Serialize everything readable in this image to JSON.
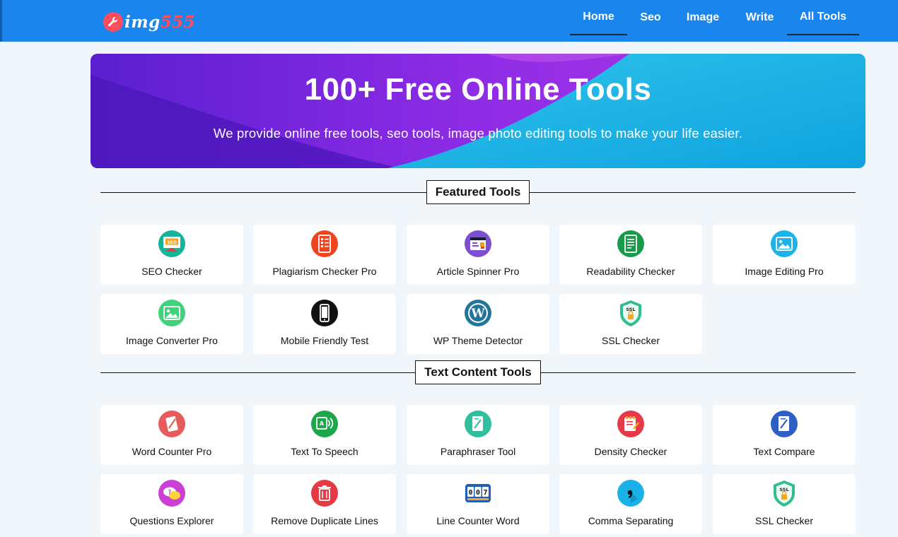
{
  "brand": {
    "logo_text_prefix": "img",
    "logo_text_number": "555"
  },
  "nav": {
    "items": [
      {
        "label": "Home",
        "active": true
      },
      {
        "label": "Seo",
        "active": false
      },
      {
        "label": "Image",
        "active": false
      },
      {
        "label": "Write",
        "active": false
      },
      {
        "label": "All Tools",
        "active": true
      }
    ]
  },
  "hero": {
    "title": "100+ Free Online Tools",
    "subtitle": "We provide online free tools, seo tools, image photo editing tools to make your life easier."
  },
  "sections": [
    {
      "title": "Featured Tools",
      "tools": [
        {
          "label": "SEO Checker",
          "icon": "seo-monitor-icon",
          "color": "#15b39a"
        },
        {
          "label": "Plagiarism Checker Pro",
          "icon": "checklist-icon",
          "color": "#f0441f"
        },
        {
          "label": "Article Spinner Pro",
          "icon": "article-icon",
          "color": "#7c4fd1"
        },
        {
          "label": "Readability Checker",
          "icon": "document-icon",
          "color": "#189a4a"
        },
        {
          "label": "Image Editing Pro",
          "icon": "image-icon",
          "color": "#1eb3e8"
        },
        {
          "label": "Image Converter Pro",
          "icon": "image-convert-icon",
          "color": "#3fd27a"
        },
        {
          "label": "Mobile Friendly Test",
          "icon": "mobile-icon",
          "color": "#111111"
        },
        {
          "label": "WP Theme Detector",
          "icon": "wordpress-icon",
          "color": "#21759b"
        },
        {
          "label": "SSL Checker",
          "icon": "ssl-shield-icon",
          "color": "#2fbf8f"
        }
      ]
    },
    {
      "title": "Text Content Tools",
      "tools": [
        {
          "label": "Word Counter Pro",
          "icon": "word-counter-icon",
          "color": "#e85b5b"
        },
        {
          "label": "Text To Speech",
          "icon": "text-speech-icon",
          "color": "#1ea74a"
        },
        {
          "label": "Paraphraser Tool",
          "icon": "paraphrase-icon",
          "color": "#2fbf9e"
        },
        {
          "label": "Density Checker",
          "icon": "density-icon",
          "color": "#e63a4a"
        },
        {
          "label": "Text Compare",
          "icon": "compare-icon",
          "color": "#2f5fc4"
        },
        {
          "label": "Questions Explorer",
          "icon": "question-bubbles-icon",
          "color": "#cc3fd6"
        },
        {
          "label": "Remove Duplicate Lines",
          "icon": "trash-icon",
          "color": "#e63946"
        },
        {
          "label": "Line Counter Word",
          "icon": "counter-icon",
          "color": "#1f5fb8"
        },
        {
          "label": "Comma Separating",
          "icon": "comma-icon",
          "color": "#1ab1e6"
        },
        {
          "label": "SSL Checker",
          "icon": "ssl-shield-icon",
          "color": "#2fbf8f"
        }
      ]
    }
  ]
}
